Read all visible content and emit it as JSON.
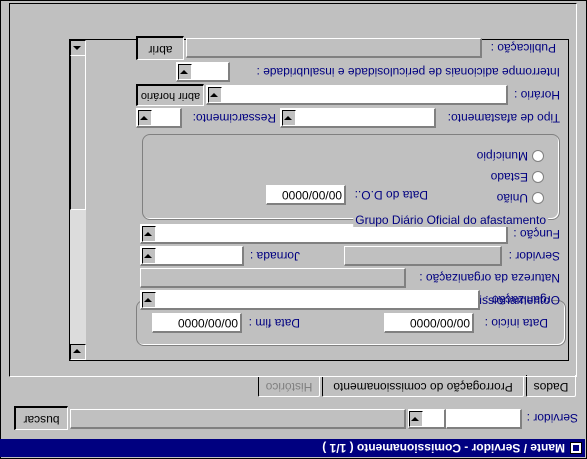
{
  "window": {
    "title": "Mante / Servidor - Comissionamento ( 1/1 )"
  },
  "search": {
    "servidor_label": "Servidor :",
    "servidor_value": "",
    "buscar_label": "buscar"
  },
  "tabs": [
    "Dados",
    "Prorrogação do comissionamento",
    "Histórico"
  ],
  "periodo": {
    "group_title": "Período de comissionamento",
    "data_inicio_label": "Data início :",
    "data_inicio_value": "00/00/0000",
    "data_fim_label": "Data fim :",
    "data_fim_value": "00/00/0000"
  },
  "fields": {
    "organizacao_label": "Organização :",
    "natureza_label": "Natureza da organização :",
    "servidor_label": "Servidor :",
    "jornada_label": "Jornada :",
    "funcao_label": "Função :",
    "tipo_afastamento_label": "Tipo de afastamento:",
    "ressarcimento_label": "Ressarcimento:",
    "horario_label": "Horário :",
    "horario_button": "abrir horário",
    "interrompe_label": "Interrompe adicionais de periculosidade e insalubridade :",
    "publicacao_label": "Publicação :",
    "publicacao_button": "abrir"
  },
  "diario": {
    "group_title": "Grupo Diário Oficial do afastamento",
    "options": [
      "União",
      "Estado",
      "Município"
    ],
    "data_do_label": "Data do D.O.:",
    "data_do_value": "00/00/0000"
  },
  "colors": {
    "title_bar": "#000080",
    "label": "#000080",
    "face": "#c0c0c0"
  }
}
